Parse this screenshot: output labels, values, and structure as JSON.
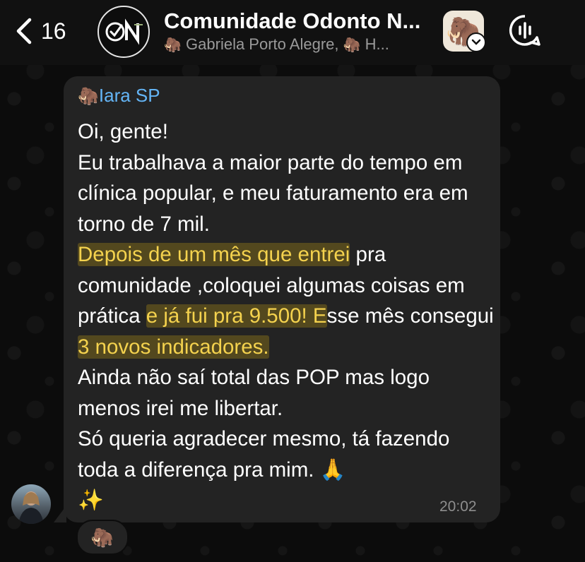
{
  "header": {
    "back_count": "16",
    "group_title": "Comunidade Odonto N...",
    "members_1": "Gabriela Porto Alegre,",
    "members_2": "H...",
    "member_emoji": "🦣",
    "my_avatar_emoji": "🦣"
  },
  "message": {
    "sender_emoji": "🦣",
    "sender_name": "Iara SP",
    "line_1": "Oi, gente!",
    "line_2": "Eu trabalhava a maior parte do tempo em clínica popular, e meu faturamento era em torno de 7 mil.",
    "hl_1": "Depois de um mês que entrei",
    "text_3a": " pra comunidade ,coloquei algumas coisas em prática ",
    "hl_2": "e já fui pra 9.500! E",
    "text_3b": "sse mês consegui ",
    "hl_3": "3 novos indicadores.",
    "line_4": "Ainda não saí total das POP mas logo menos irei me libertar.",
    "line_5": "Só queria agradecer mesmo, tá fazendo toda a diferença pra mim.",
    "line_5_emoji": "🙏",
    "line_6_emoji": "✨",
    "time": "20:02",
    "reaction": "🦣"
  },
  "colors": {
    "header_bg": "#111111",
    "bubble_bg": "#232323",
    "sender_name": "#64b5f6",
    "highlight_text": "#f4d24e",
    "timestamp": "#8e8e8e"
  },
  "icons": {
    "back": "chevron-left-icon",
    "badge": "chevron-down-icon",
    "audio": "audio-wave-icon"
  }
}
